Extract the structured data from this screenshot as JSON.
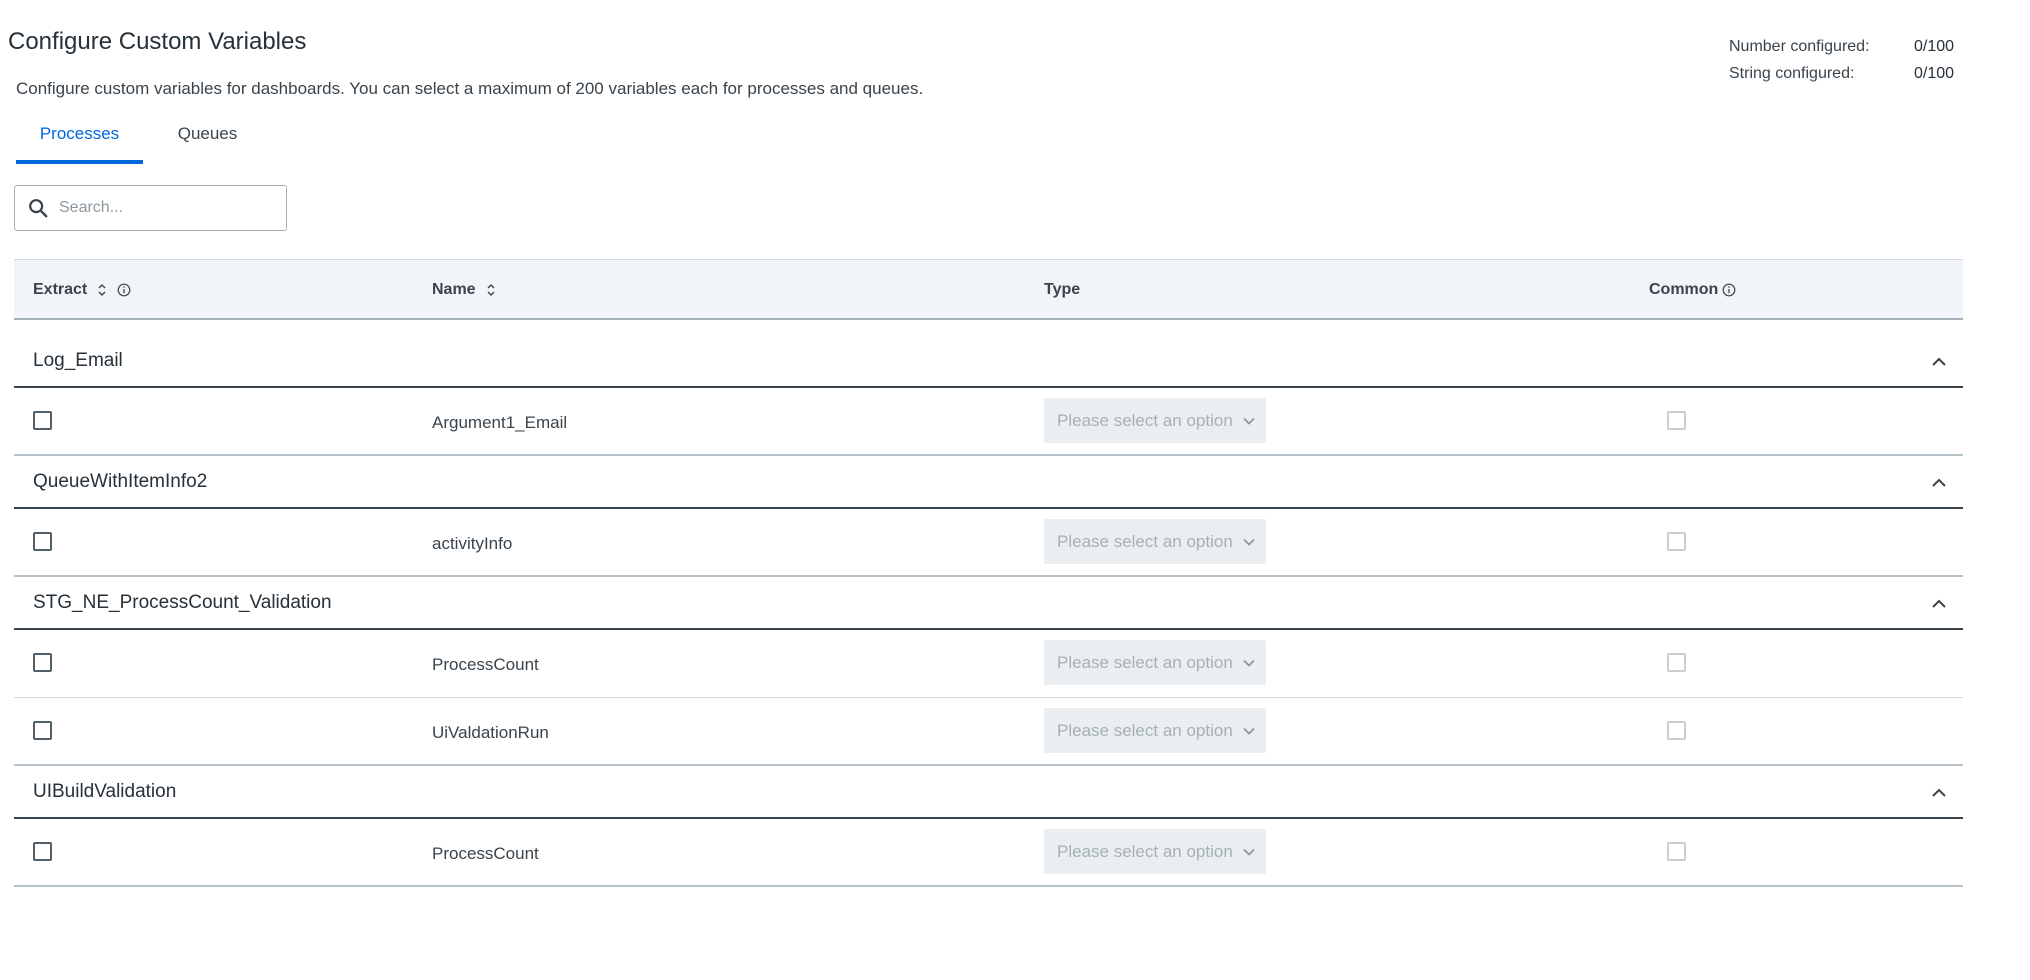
{
  "page": {
    "title": "Configure Custom Variables",
    "description": "Configure custom variables for dashboards. You can select a maximum of 200 variables each for processes and queues."
  },
  "stats": {
    "number_label": "Number configured:",
    "number_value": "0/100",
    "string_label": "String configured:",
    "string_value": "0/100"
  },
  "tabs": [
    {
      "label": "Processes",
      "active": true
    },
    {
      "label": "Queues",
      "active": false
    }
  ],
  "search": {
    "placeholder": "Search...",
    "value": ""
  },
  "table": {
    "columns": {
      "extract": "Extract",
      "name": "Name",
      "type": "Type",
      "common": "Common"
    },
    "type_placeholder": "Please select an option",
    "groups": [
      {
        "title": "Log_Email",
        "items": [
          {
            "name": "Argument1_Email",
            "extract": false,
            "common": false
          }
        ]
      },
      {
        "title": "QueueWithItemInfo2",
        "items": [
          {
            "name": "activityInfo",
            "extract": false,
            "common": false
          }
        ]
      },
      {
        "title": "STG_NE_ProcessCount_Validation",
        "items": [
          {
            "name": "ProcessCount",
            "extract": false,
            "common": false
          },
          {
            "name": "UiValdationRun",
            "extract": false,
            "common": false
          }
        ]
      },
      {
        "title": "UIBuildValidation",
        "items": [
          {
            "name": "ProcessCount",
            "extract": false,
            "common": false
          }
        ]
      }
    ]
  },
  "colors": {
    "accent": "#0067df",
    "text": "#273139",
    "header_bg": "#f1f4f8"
  },
  "icons": {
    "search": "search-icon",
    "sort": "sort-icon",
    "info": "info-icon",
    "collapse": "chevron-up-icon",
    "dropdown": "chevron-down-icon"
  }
}
